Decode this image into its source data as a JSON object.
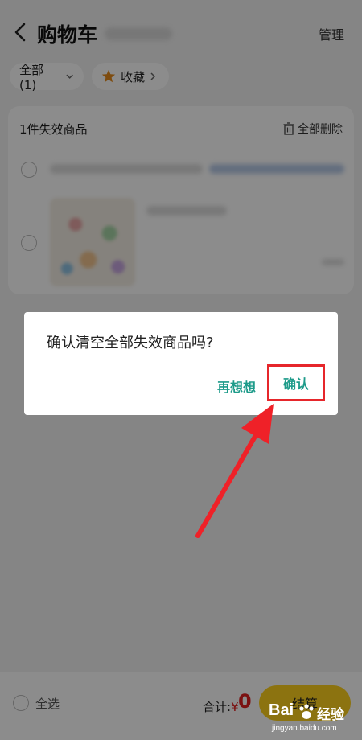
{
  "header": {
    "title": "购物车",
    "manage_label": "管理",
    "back_icon": "chevron-left-icon"
  },
  "filters": {
    "all_label": "全部 (1)",
    "favorites_label": "收藏",
    "star_color": "#e58a1c"
  },
  "invalid_section": {
    "title": "1件失效商品",
    "delete_all_label": "全部删除"
  },
  "footer": {
    "select_all_label": "全选",
    "total_label": "合计:",
    "currency": "¥",
    "total_value": "0",
    "checkout_label": "结算"
  },
  "dialog": {
    "message": "确认清空全部失效商品吗?",
    "cancel_label": "再想想",
    "confirm_label": "确认"
  },
  "watermark": {
    "brand": "Bai",
    "brand_suffix": "经验",
    "url": "jingyan.baidu.com"
  },
  "colors": {
    "accent_teal": "#1e9b8a",
    "highlight_red": "#e6262b",
    "price_red": "#e02020",
    "checkout_yellow": "#ffd21e"
  }
}
